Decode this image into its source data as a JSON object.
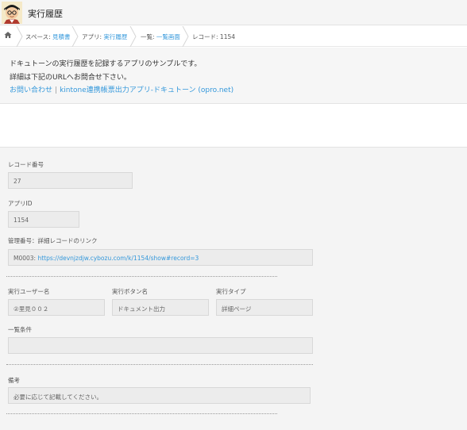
{
  "header": {
    "title": "実行履歴"
  },
  "breadcrumb": {
    "items": [
      {
        "prefix": "スペース: ",
        "link": "見積書"
      },
      {
        "prefix": "アプリ: ",
        "link": "実行履歴"
      },
      {
        "prefix": "一覧: ",
        "link": "一覧画面"
      },
      {
        "prefix": "レコード: ",
        "link": "1154"
      }
    ]
  },
  "notice": {
    "line1": "ドキュトーンの実行履歴を記録するアプリのサンプルです。",
    "line2": "詳細は下記のURLへお問合せ下さい。",
    "link1": "お問い合わせ",
    "link2": "kintone連携帳票出力アプリ-ドキュトーン (opro.net)"
  },
  "fields": {
    "record_number": {
      "label": "レコード番号",
      "value": "27"
    },
    "app_id": {
      "label": "アプリID",
      "value": "1154"
    },
    "manage_number": {
      "label": "管理番号：詳細レコードのリンク",
      "prefix": "M0003: ",
      "link": "https://devnjzdjw.cybozu.com/k/1154/show#record=3"
    },
    "user_name": {
      "label": "実行ユーザー名",
      "value": "②里見００２"
    },
    "button_name": {
      "label": "実行ボタン名",
      "value": "ドキュメント出力"
    },
    "exec_type": {
      "label": "実行タイプ",
      "value": "詳細ページ"
    },
    "list_condition": {
      "label": "一覧条件",
      "value": ""
    },
    "remarks": {
      "label": "備考",
      "value": "必要に応じて記載してください。"
    }
  }
}
